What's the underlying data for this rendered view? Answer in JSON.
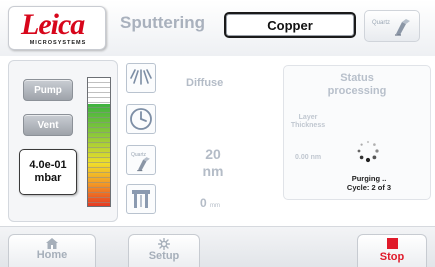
{
  "header": {
    "logo": {
      "wordmark": "Leica",
      "subtext": "MICROSYSTEMS"
    },
    "process_title": "Sputtering",
    "material": "Copper",
    "quartz_button": {
      "label": "Quartz",
      "icon": "quartz-crystal-icon"
    }
  },
  "vacuum": {
    "pump_label": "Pump",
    "vent_label": "Vent",
    "pressure_value": "4.0e-01",
    "pressure_unit": "mbar",
    "gauge_level_fraction": 0.8,
    "gauge_colors": [
      "#3fb33f",
      "#f0de2a",
      "#e63a22"
    ]
  },
  "controls": {
    "mode_icon": "diffuse-spray-icon",
    "mode_label": "Diffuse",
    "timer_icon": "clock-icon",
    "thickness_icon": "quartz-crystal-icon",
    "thickness_icon_label": "Quartz",
    "thickness_value": "20",
    "thickness_unit": "nm",
    "height_icon": "working-distance-icon",
    "height_value": "0",
    "height_unit": "mm"
  },
  "status": {
    "title_line1": "Status",
    "title_line2": "processing",
    "layer_label_line1": "Layer",
    "layer_label_line2": "Thickness",
    "layer_value": "0.00 nm",
    "message_line1": "Purging ..",
    "message_line2": "Cycle: 2 of 3"
  },
  "footer": {
    "home_label": "Home",
    "setup_label": "Setup",
    "stop_label": "Stop",
    "stop_color": "#e01a2a"
  }
}
